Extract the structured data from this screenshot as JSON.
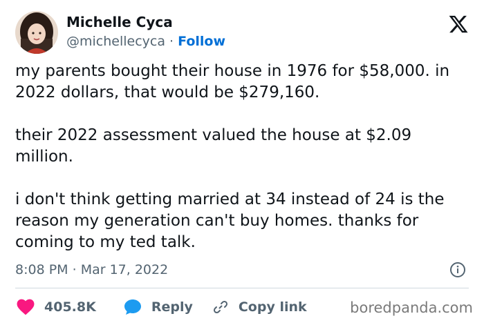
{
  "user": {
    "display_name": "Michelle Cyca",
    "handle": "@michellecyca",
    "separator": "·",
    "follow_label": "Follow",
    "avatar_icon": "profile-photo"
  },
  "brand": {
    "logo_icon": "x-logo"
  },
  "tweet": {
    "paragraphs": [
      "my parents bought their house in 1976 for $58,000. in 2022 dollars, that would be $279,160.",
      "their 2022 assessment valued the house at $2.09 million.",
      "i don't think getting married at 34 instead of 24 is the reason my generation can't buy homes. thanks for coming to my ted talk."
    ],
    "time": "8:08 PM",
    "date_separator": "·",
    "date": "Mar 17, 2022"
  },
  "actions": {
    "like_count": "405.8K",
    "reply_label": "Reply",
    "copy_link_label": "Copy link"
  },
  "watermark": "boredpanda.com",
  "colors": {
    "link_blue": "#006fd6",
    "heart_red": "#f91880",
    "reply_blue": "#1d9bf0",
    "muted_gray": "#536471",
    "text": "#0f1419"
  }
}
